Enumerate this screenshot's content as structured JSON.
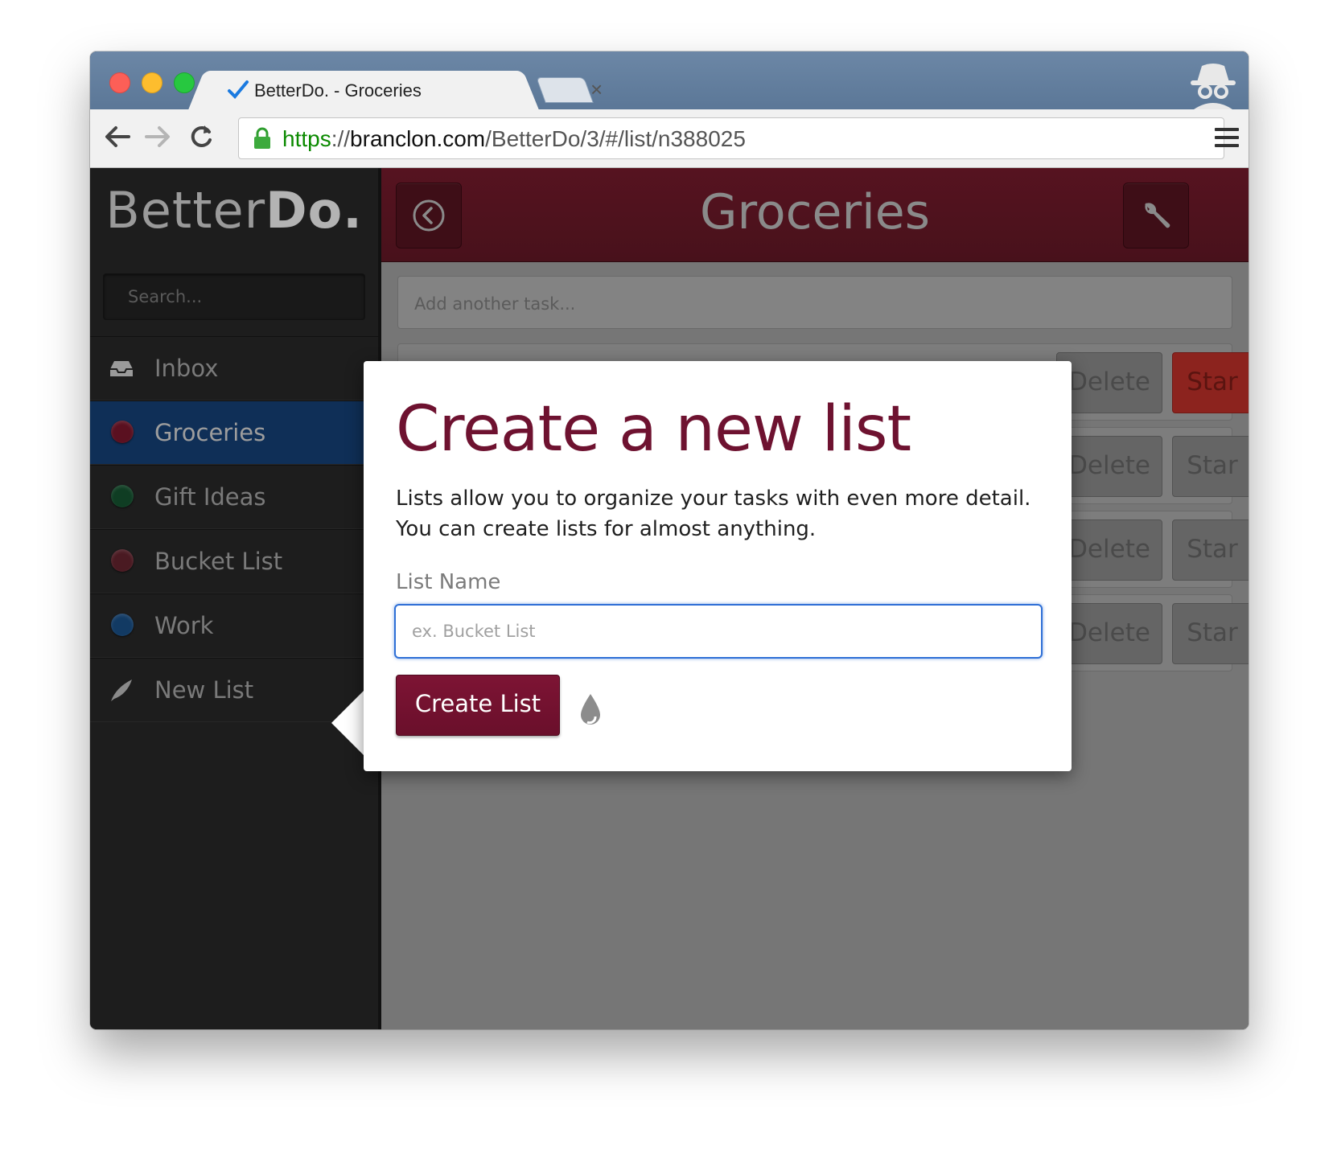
{
  "browser": {
    "tab_title": "BetterDo. - Groceries",
    "tab_close": "×",
    "url_scheme": "https",
    "url_sep": "://",
    "url_host": "branclon.com",
    "url_path": "/BetterDo/3/#/list/n388025"
  },
  "app": {
    "brand_light": "Better",
    "brand_bold": "Do.",
    "search_placeholder": "Search...",
    "nav": [
      {
        "label": "Inbox",
        "icon": "inbox-icon"
      },
      {
        "label": "Groceries",
        "color": "#5a1020",
        "active": true
      },
      {
        "label": "Gift Ideas",
        "color": "#0f3d23"
      },
      {
        "label": "Bucket List",
        "color": "#4a1a22"
      },
      {
        "label": "Work",
        "color": "#123a63"
      },
      {
        "label": "New List",
        "icon": "feather-icon"
      }
    ],
    "header_title": "Groceries",
    "add_task_placeholder": "Add another task...",
    "task_rows": [
      {
        "delete": "Delete",
        "star": "Star",
        "starred": true
      },
      {
        "delete": "Delete",
        "star": "Star",
        "starred": false
      },
      {
        "delete": "Delete",
        "star": "Star",
        "starred": false
      },
      {
        "delete": "Delete",
        "star": "Star",
        "starred": false
      }
    ]
  },
  "popover": {
    "title": "Create a new list",
    "description": "Lists allow you to organize your tasks with even more detail. You can create lists for almost anything.",
    "field_label": "List Name",
    "field_placeholder": "ex. Bucket List",
    "field_value": "",
    "submit_label": "Create List"
  },
  "colors": {
    "accent": "#6e1230",
    "header_bg": "#561320",
    "active_nav": "#0f2f57",
    "focus_ring": "#2e6fd6"
  }
}
